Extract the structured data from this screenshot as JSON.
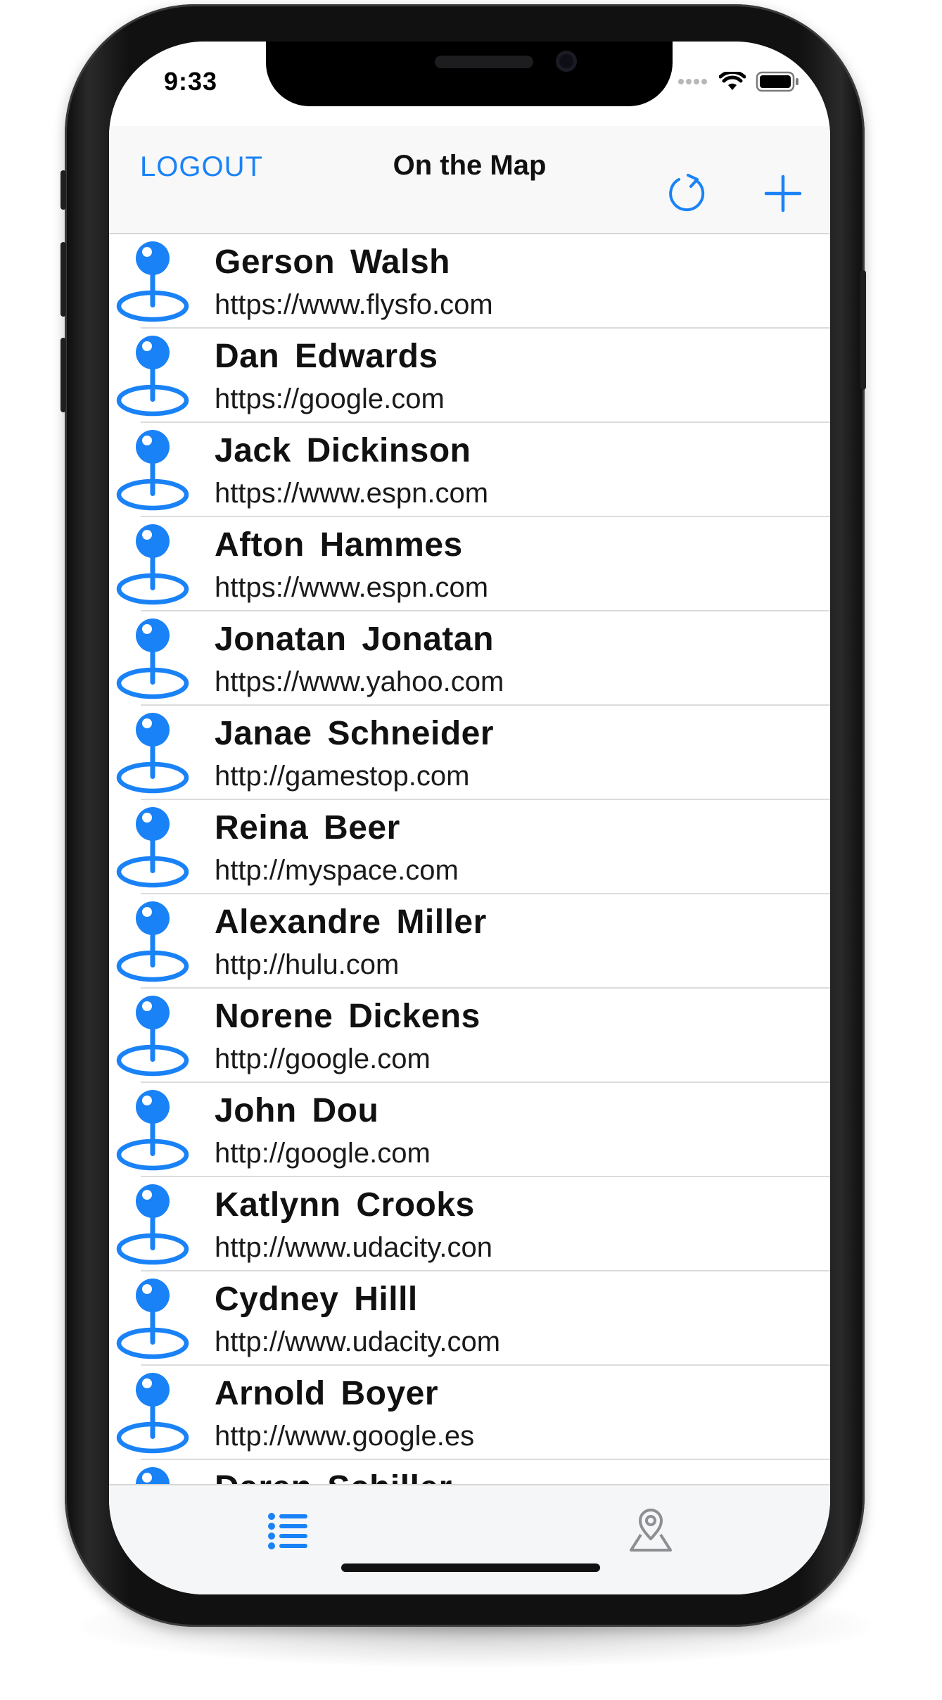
{
  "status_bar": {
    "time": "9:33"
  },
  "navigation": {
    "title": "On the Map",
    "logout_label": "LOGOUT",
    "refresh_icon": "refresh-icon",
    "add_icon": "plus-icon"
  },
  "accent_color": "#1a82f7",
  "students": [
    {
      "name": "Gerson Walsh",
      "url": "https://www.flysfo.com"
    },
    {
      "name": "Dan Edwards",
      "url": "https://google.com"
    },
    {
      "name": "Jack Dickinson",
      "url": "https://www.espn.com"
    },
    {
      "name": "Afton Hammes",
      "url": "https://www.espn.com"
    },
    {
      "name": "Jonatan Jonatan",
      "url": "https://www.yahoo.com"
    },
    {
      "name": "Janae Schneider",
      "url": "http://gamestop.com"
    },
    {
      "name": "Reina Beer",
      "url": "http://myspace.com"
    },
    {
      "name": "Alexandre Miller",
      "url": "http://hulu.com"
    },
    {
      "name": "Norene Dickens",
      "url": "http://google.com"
    },
    {
      "name": "John Dou",
      "url": "http://google.com"
    },
    {
      "name": "Katlynn Crooks",
      "url": "http://www.udacity.con"
    },
    {
      "name": "Cydney Hilll",
      "url": "http://www.udacity.com"
    },
    {
      "name": "Arnold Boyer",
      "url": "http://www.google.es"
    },
    {
      "name": "Daren Schiller",
      "url": ""
    }
  ],
  "tab_bar": {
    "tabs": [
      {
        "icon": "list-icon",
        "selected": true
      },
      {
        "icon": "map-pin-icon",
        "selected": false
      }
    ]
  }
}
